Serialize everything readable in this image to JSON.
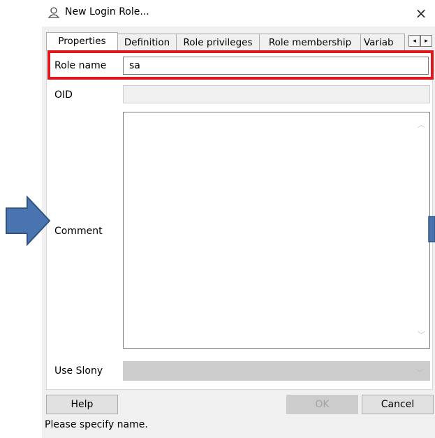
{
  "window": {
    "title": "New Login Role...",
    "close_glyph": "×"
  },
  "tabs": [
    {
      "label": "Properties",
      "active": true
    },
    {
      "label": "Definition",
      "active": false
    },
    {
      "label": "Role privileges",
      "active": false
    },
    {
      "label": "Role membership",
      "active": false
    },
    {
      "label": "Variab",
      "active": false
    }
  ],
  "tab_scroll": {
    "left": "◂",
    "right": "▸"
  },
  "form": {
    "role_name_label": "Role name",
    "role_name_value": "sa",
    "oid_label": "OID",
    "oid_value": "",
    "comment_label": "Comment",
    "comment_value": "",
    "use_slony_label": "Use Slony",
    "use_slony_value": ""
  },
  "buttons": {
    "help": "Help",
    "ok": "OK",
    "cancel": "Cancel"
  },
  "status_text": "Please specify name.",
  "colors": {
    "highlight": "#e0161d",
    "arrow_fill": "#4a74b0",
    "arrow_stroke": "#2f5383"
  },
  "icons": {
    "title": "user-icon",
    "scroll_up": "chevron-up-icon",
    "scroll_down": "chevron-down-icon",
    "combo": "chevron-down-icon",
    "pointer": "arrow-right-icon"
  }
}
